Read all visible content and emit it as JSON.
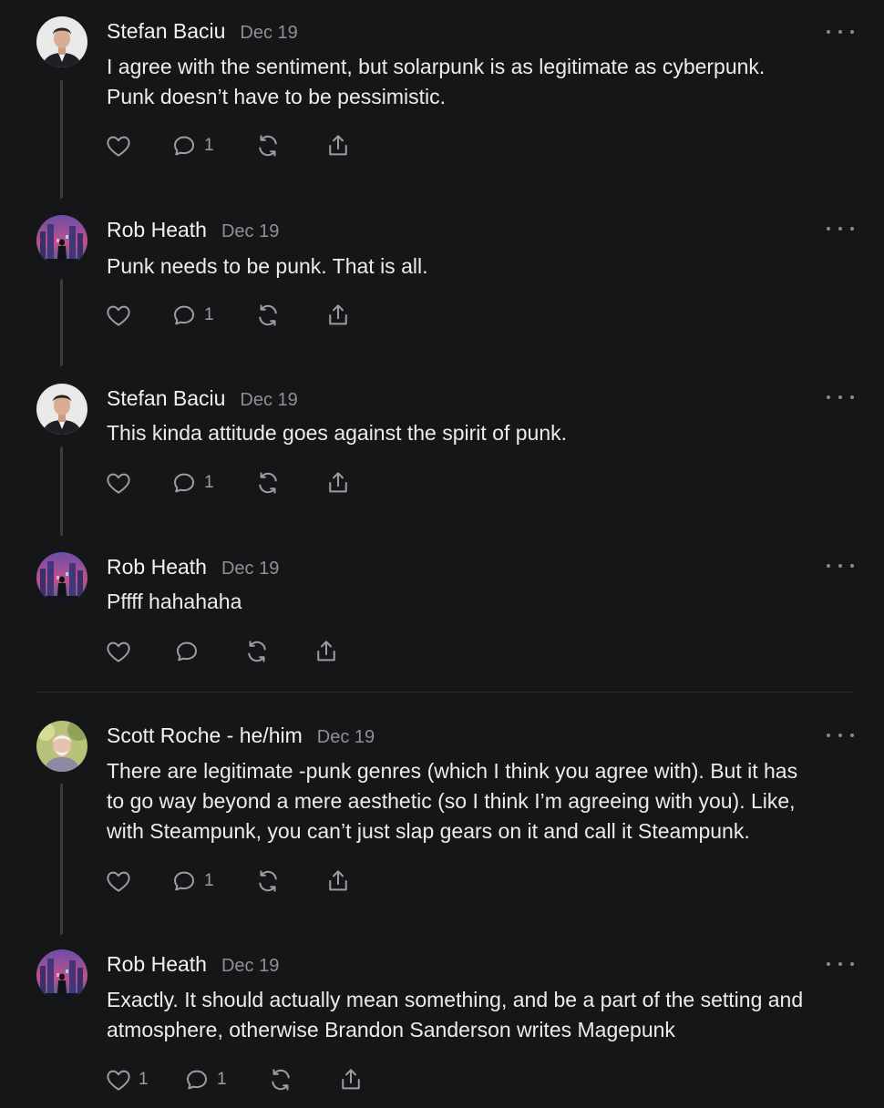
{
  "comments": [
    {
      "author": "Stefan Baciu",
      "date": "Dec 19",
      "avatar": "man-suit-portrait",
      "lines": [
        "I agree with the sentiment, but solarpunk is as legitimate as cyberpunk.",
        "Punk doesn’t have to be pessimistic."
      ],
      "likes": "",
      "replies": "1"
    },
    {
      "author": "Rob Heath",
      "date": "Dec 19",
      "avatar": "neon-city-figure",
      "lines": [
        "Punk needs to be punk. That is all."
      ],
      "likes": "",
      "replies": "1"
    },
    {
      "author": "Stefan Baciu",
      "date": "Dec 19",
      "avatar": "man-suit-portrait",
      "lines": [
        "This kinda attitude goes against the spirit of punk."
      ],
      "likes": "",
      "replies": "1"
    },
    {
      "author": "Rob Heath",
      "date": "Dec 19",
      "avatar": "neon-city-figure",
      "lines": [
        "Pffff hahahaha"
      ],
      "likes": "",
      "replies": ""
    },
    {
      "author": "Scott Roche - he/him",
      "date": "Dec 19",
      "avatar": "older-man-outdoors",
      "lines": [
        "There are legitimate -punk genres (which I think you agree with). But it has",
        "to go way beyond a mere aesthetic (so I think I’m agreeing with you). Like,",
        "with Steampunk, you can’t just slap gears on it and call it Steampunk."
      ],
      "likes": "",
      "replies": "1"
    },
    {
      "author": "Rob Heath",
      "date": "Dec 19",
      "avatar": "neon-city-figure",
      "lines": [
        "Exactly. It should actually mean something, and be a part of the setting and",
        "atmosphere, otherwise Brandon Sanderson writes Magepunk"
      ],
      "likes": "1",
      "replies": "1"
    }
  ],
  "icons": {
    "like": "heart-icon",
    "reply": "comment-bubble-icon",
    "restack": "restack-arrows-icon",
    "share": "share-upload-icon",
    "more": "more-dots-icon"
  },
  "colors": {
    "background": "#151618",
    "text": "#ececec",
    "muted": "#8f9094",
    "thread_line": "#3a3b3e"
  }
}
